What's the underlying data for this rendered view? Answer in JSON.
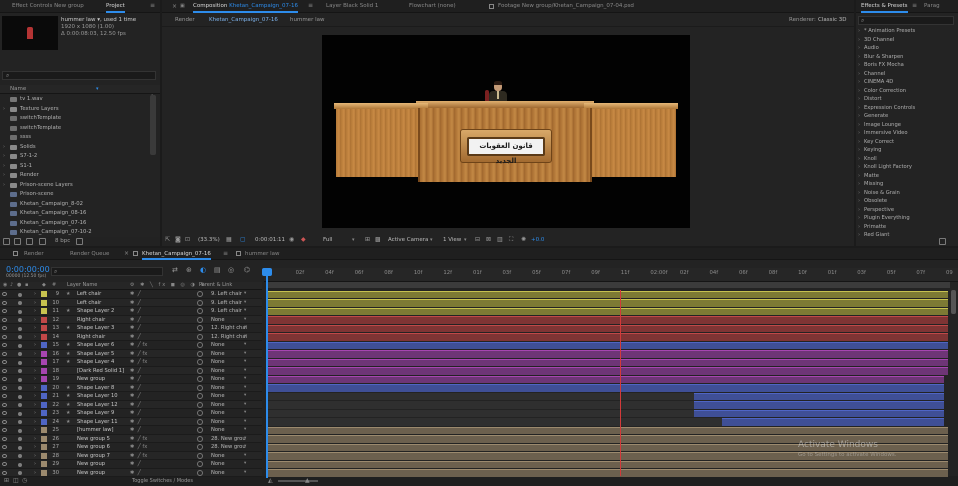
{
  "top_left": {
    "effect_controls_tab": "Effect Controls New group",
    "project_tab": "Project",
    "footage_name": "hummer law ▾, used 1 time",
    "footage_res": "1920 x 1080 (1.00)",
    "footage_dur": "Δ 0:00:08:03, 12.50 fps",
    "col_name": "Name",
    "items": [
      {
        "label": "tv 1.wav",
        "kind": "aud",
        "tw": ""
      },
      {
        "label": "Texture Layers",
        "kind": "folder",
        "tw": "›"
      },
      {
        "label": "switchTemplate",
        "kind": "file",
        "tw": ""
      },
      {
        "label": "switchTemplate",
        "kind": "file",
        "tw": ""
      },
      {
        "label": "ssss",
        "kind": "file",
        "tw": ""
      },
      {
        "label": "Solids",
        "kind": "folder",
        "tw": "›"
      },
      {
        "label": "S7-1-2",
        "kind": "folder",
        "tw": "›"
      },
      {
        "label": "S1-1",
        "kind": "folder",
        "tw": "›"
      },
      {
        "label": "Render",
        "kind": "folder",
        "tw": "›"
      },
      {
        "label": "Prison-scene Layers",
        "kind": "folder",
        "tw": "›"
      },
      {
        "label": "Prison-scene",
        "kind": "comp",
        "tw": ""
      },
      {
        "label": "Khetan_Campaign_8-02",
        "kind": "comp",
        "tw": ""
      },
      {
        "label": "Khetan_Campaign_08-16",
        "kind": "comp",
        "tw": ""
      },
      {
        "label": "Khetan_Campaign_07-16",
        "kind": "comp",
        "tw": ""
      },
      {
        "label": "Khetan_Campaign_07-10-2",
        "kind": "comp",
        "tw": ""
      }
    ],
    "bpc": "8 bpc"
  },
  "center": {
    "comp_tab_prefix": "Composition ",
    "comp_tab_name": "Khetan_Campaign_07-16",
    "layer_tab": "Layer Black Solid 1",
    "flowchart_tab": "Flowchart (none)",
    "footage_tab": "Footage New group/Khetan_Campaign_07-04.psd",
    "crumb_render": "Render",
    "crumb_comp": "Khetan_Campaign_07-16",
    "crumb_layer": "hummer law",
    "renderer_label": "Renderer:",
    "renderer_value": "Classic 3D",
    "podium_text": "قانون العقوبات الجديد",
    "zoom": "(33.3%)",
    "timecode": "0:00:01:11",
    "resolution": "Full",
    "camera": "Active Camera",
    "view": "1 View",
    "exposure": "+0.0"
  },
  "right": {
    "effects_tab": "Effects & Presets",
    "parag_tab": "Parag",
    "categories": [
      "* Animation Presets",
      "3D Channel",
      "Audio",
      "Blur & Sharpen",
      "Boris FX Mocha",
      "Channel",
      "CINEMA 4D",
      "Color Correction",
      "Distort",
      "Expression Controls",
      "Generate",
      "Image Lounge",
      "Immersive Video",
      "Key Correct",
      "Keying",
      "Knoll",
      "Knoll Light Factory",
      "Matte",
      "Missing",
      "Noise & Grain",
      "Obsolete",
      "Perspective",
      "Plugin Everything",
      "Primatte",
      "Red Giant"
    ]
  },
  "timeline": {
    "tabs": [
      "Render",
      "Render Queue",
      "Khetan_Campaign_07-16",
      "hummer law"
    ],
    "current_time": "0:00:00:00",
    "fps_sub": "00000 (12.50 fps)",
    "col_layer_name": "Layer Name",
    "col_parent": "Parent & Link",
    "ruler": [
      "0f",
      "02f",
      "04f",
      "06f",
      "08f",
      "10f",
      "12f",
      "01f",
      "03f",
      "05f",
      "07f",
      "09f",
      "11f",
      "02:00f",
      "02f",
      "04f",
      "06f",
      "08f",
      "10f",
      "01f",
      "03f",
      "05f",
      "07f",
      "09"
    ],
    "toggle": "Toggle Switches / Modes",
    "layers": [
      {
        "num": "9",
        "name": "Left chair",
        "color": "#c7c24f",
        "type": "★",
        "parent": "9. Left chair",
        "bar": "#7d7a34",
        "fx": ""
      },
      {
        "num": "10",
        "name": "Left chair",
        "color": "#c7c24f",
        "type": "",
        "parent": "9. Left chair",
        "bar": "#7d7a34",
        "fx": ""
      },
      {
        "num": "11",
        "name": "Shape Layer 2",
        "color": "#c7c24f",
        "type": "★",
        "parent": "9. Left chair",
        "bar": "#7d7a34",
        "fx": ""
      },
      {
        "num": "12",
        "name": "Right chair",
        "color": "#c14848",
        "type": "",
        "parent": "None",
        "bar": "#7f3434",
        "fx": ""
      },
      {
        "num": "13",
        "name": "Shape Layer 3",
        "color": "#c14848",
        "type": "★",
        "parent": "12. Right chai",
        "bar": "#7f3434",
        "fx": ""
      },
      {
        "num": "14",
        "name": "Right chair",
        "color": "#c14848",
        "type": "",
        "parent": "12. Right chai",
        "bar": "#7f3434",
        "fx": ""
      },
      {
        "num": "15",
        "name": "Shape Layer 6",
        "color": "#4f65c4",
        "type": "★",
        "parent": "None",
        "bar": "#3f4f96",
        "fx": "fx"
      },
      {
        "num": "16",
        "name": "Shape Layer 5",
        "color": "#a645b0",
        "type": "★",
        "parent": "None",
        "bar": "#6e3576",
        "fx": "fx"
      },
      {
        "num": "17",
        "name": "Shape Layer 4",
        "color": "#a645b0",
        "type": "★",
        "parent": "None",
        "bar": "#6e3576",
        "fx": "fx"
      },
      {
        "num": "18",
        "name": "[Dark Red Solid 1]",
        "color": "#a645b0",
        "type": "",
        "parent": "None",
        "bar": "#6e3576",
        "fx": ""
      },
      {
        "num": "19",
        "name": "New group",
        "color": "#a645b0",
        "type": "",
        "parent": "None",
        "bar": "#6e3576",
        "fx": ""
      },
      {
        "num": "20",
        "name": "Shape Layer 8",
        "color": "#4f65c4",
        "type": "★",
        "parent": "None",
        "bar": "#3f4f96",
        "fx": ""
      },
      {
        "num": "21",
        "name": "Shape Layer 10",
        "color": "#4f65c4",
        "type": "★",
        "parent": "None",
        "bar": "#3f4f96",
        "fx": ""
      },
      {
        "num": "22",
        "name": "Shape Layer 12",
        "color": "#4f65c4",
        "type": "★",
        "parent": "None",
        "bar": "#3f4f96",
        "fx": ""
      },
      {
        "num": "23",
        "name": "Shape Layer 9",
        "color": "#4f65c4",
        "type": "★",
        "parent": "None",
        "bar": "#3f4f96",
        "fx": ""
      },
      {
        "num": "24",
        "name": "Shape Layer 11",
        "color": "#4f65c4",
        "type": "★",
        "parent": "None",
        "bar": "#3f4f96",
        "fx": ""
      },
      {
        "num": "25",
        "name": "[hummer law]",
        "color": "#9c8a6e",
        "type": "",
        "parent": "None",
        "bar": "#6c604e",
        "fx": ""
      },
      {
        "num": "26",
        "name": "New group 5",
        "color": "#9c8a6e",
        "type": "",
        "parent": "28. New grou",
        "bar": "#6c604e",
        "fx": "fx"
      },
      {
        "num": "27",
        "name": "New group 6",
        "color": "#9c8a6e",
        "type": "",
        "parent": "28. New grou",
        "bar": "#6c604e",
        "fx": "fx"
      },
      {
        "num": "28",
        "name": "New group 7",
        "color": "#9c8a6e",
        "type": "",
        "parent": "None",
        "bar": "#6c604e",
        "fx": "fx"
      },
      {
        "num": "29",
        "name": "New group",
        "color": "#9c8a6e",
        "type": "",
        "parent": "None",
        "bar": "#6c604e",
        "fx": ""
      },
      {
        "num": "30",
        "name": "New group",
        "color": "#9c8a6e",
        "type": "",
        "parent": "None",
        "bar": "#6c604e",
        "fx": ""
      }
    ]
  },
  "watermark": {
    "title": "Activate Windows",
    "sub": "Go to Settings to activate Windows."
  }
}
